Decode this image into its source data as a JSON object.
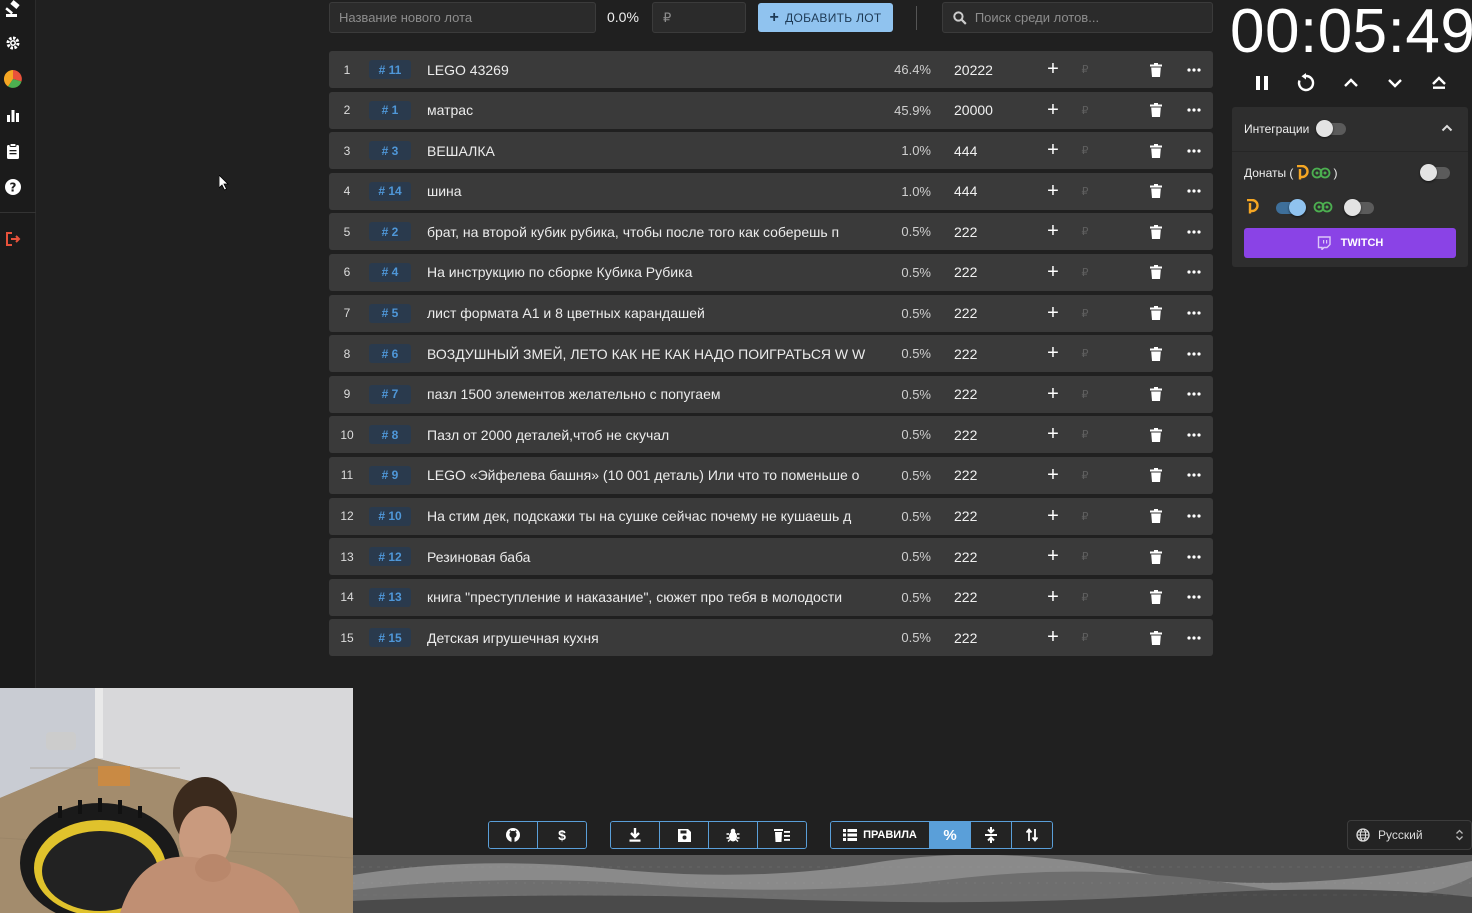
{
  "top_bar": {
    "lot_name_placeholder": "Название нового лота",
    "percent_label": "0.0%",
    "amount_placeholder": "₽",
    "add_button_label": "ДОБАВИТЬ ЛОТ",
    "search_placeholder": "Поиск среди лотов..."
  },
  "lots": [
    {
      "idx": "1",
      "id": "# 11",
      "name": "LEGO 43269",
      "pct": "46.4%",
      "amount": "20222",
      "currency": "₽"
    },
    {
      "idx": "2",
      "id": "# 1",
      "name": "матрас",
      "pct": "45.9%",
      "amount": "20000",
      "currency": "₽"
    },
    {
      "idx": "3",
      "id": "# 3",
      "name": " ВЕШАЛКА",
      "pct": "1.0%",
      "amount": "444",
      "currency": "₽"
    },
    {
      "idx": "4",
      "id": "# 14",
      "name": " шина",
      "pct": "1.0%",
      "amount": "444",
      "currency": "₽"
    },
    {
      "idx": "5",
      "id": "# 2",
      "name": "брат, на второй кубик рубика, чтобы после того как соберешь п",
      "pct": "0.5%",
      "amount": "222",
      "currency": "₽"
    },
    {
      "idx": "6",
      "id": "# 4",
      "name": "На инструкцию по сборке Кубика Рубика",
      "pct": "0.5%",
      "amount": "222",
      "currency": "₽"
    },
    {
      "idx": "7",
      "id": "# 5",
      "name": "лист формата А1 и 8 цветных карандашей",
      "pct": "0.5%",
      "amount": "222",
      "currency": "₽"
    },
    {
      "idx": "8",
      "id": "# 6",
      "name": "ВОЗДУШНЫЙ ЗМЕЙ, ЛЕТО КАК НЕ КАК НАДО ПОИГРАТЬСЯ W W",
      "pct": "0.5%",
      "amount": "222",
      "currency": "₽"
    },
    {
      "idx": "9",
      "id": "# 7",
      "name": "пазл 1500 элементов желательно с попугаем",
      "pct": "0.5%",
      "amount": "222",
      "currency": "₽"
    },
    {
      "idx": "10",
      "id": "# 8",
      "name": "Пазл от 2000 деталей,чтоб не скучал",
      "pct": "0.5%",
      "amount": "222",
      "currency": "₽"
    },
    {
      "idx": "11",
      "id": "# 9",
      "name": "LEGO «Эйфелева башня» (10 001 деталь) Или что то поменьше о",
      "pct": "0.5%",
      "amount": "222",
      "currency": "₽"
    },
    {
      "idx": "12",
      "id": "# 10",
      "name": "На стим дек, подскажи ты на сушке сейчас почему не кушаешь д",
      "pct": "0.5%",
      "amount": "222",
      "currency": "₽"
    },
    {
      "idx": "13",
      "id": "# 12",
      "name": "Резиновая баба",
      "pct": "0.5%",
      "amount": "222",
      "currency": "₽"
    },
    {
      "idx": "14",
      "id": "# 13",
      "name": "книга \"преступление и наказание\", сюжет про тебя в молодости",
      "pct": "0.5%",
      "amount": "222",
      "currency": "₽"
    },
    {
      "idx": "15",
      "id": "# 15",
      "name": "Детская игрушечная кухня",
      "pct": "0.5%",
      "amount": "222",
      "currency": "₽"
    }
  ],
  "timer": {
    "display": "00:05:49"
  },
  "integrations": {
    "title": "Интеграции",
    "donations_label": "Донаты (",
    "donations_close": ")",
    "twitch_label": "TWITCH",
    "integrations_enabled": false,
    "donations_enabled": false,
    "donatepay_enabled": true,
    "donationalerts_enabled": false
  },
  "bottom_toolbar": {
    "rules_label": "ПРАВИЛА",
    "percent_symbol": "%",
    "dollar_symbol": "$"
  },
  "language": {
    "current": "Русский"
  },
  "colors": {
    "accent": "#90c3ef",
    "twitch": "#8a43e6",
    "donatepay": "#f5a623",
    "donationalerts": "#4caf50"
  }
}
